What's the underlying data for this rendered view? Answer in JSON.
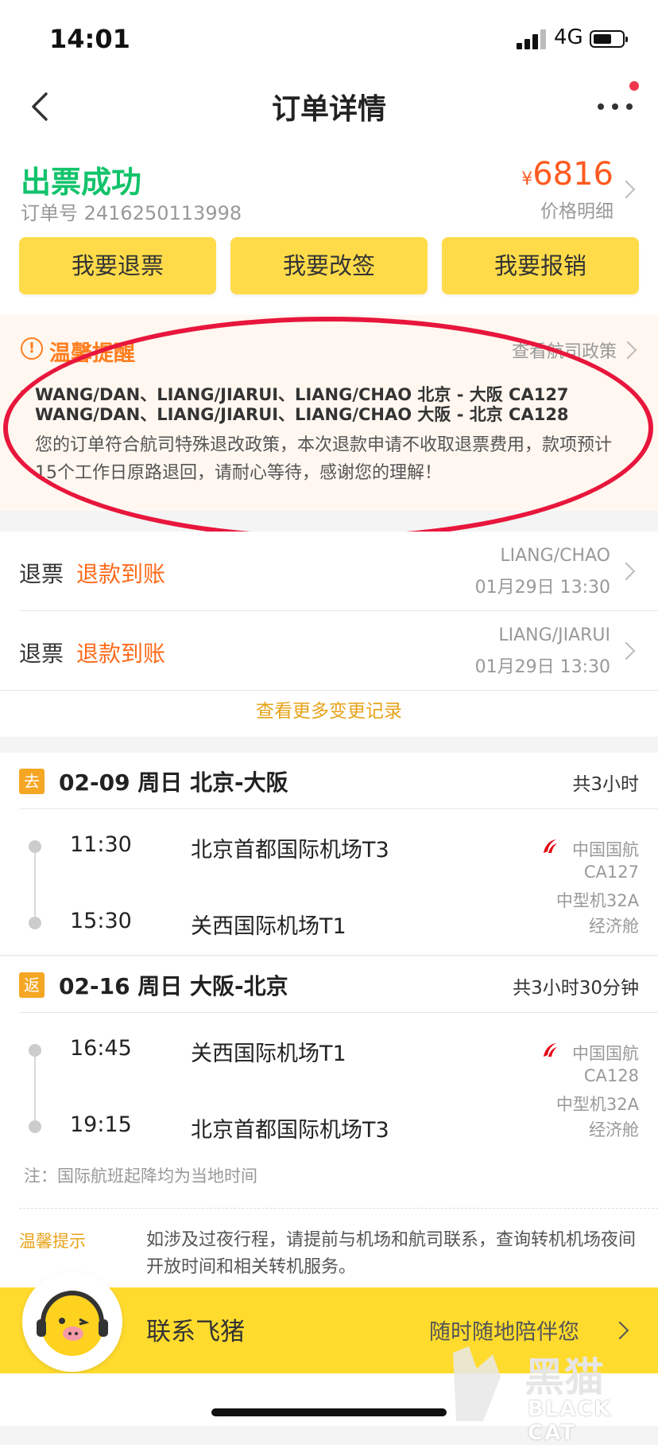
{
  "status_bar": {
    "time": "14:01",
    "network": "4G"
  },
  "nav": {
    "title": "订单详情"
  },
  "order": {
    "status": "出票成功",
    "order_no": "订单号 2416250113998",
    "currency": "¥",
    "price": "6816",
    "price_detail": "价格明细"
  },
  "actions": {
    "refund": "我要退票",
    "change": "我要改签",
    "reimburse": "我要报销"
  },
  "notice": {
    "title": "温馨提醒",
    "link": "查看航司政策",
    "pax_line_1": "WANG/DAN、LIANG/JIARUI、LIANG/CHAO 北京 - 大阪 CA127",
    "pax_line_2": "WANG/DAN、LIANG/JIARUI、LIANG/CHAO 大阪 - 北京 CA128",
    "message": "您的订单符合航司特殊退改政策，本次退款申请不收取退票费用，款项预计15个工作日原路退回，请耐心等待，感谢您的理解！"
  },
  "refunds": [
    {
      "label": "退票",
      "status": "退款到账",
      "name": "LIANG/CHAO",
      "time": "01月29日 13:30"
    },
    {
      "label": "退票",
      "status": "退款到账",
      "name": "LIANG/JIARUI",
      "time": "01月29日 13:30"
    }
  ],
  "more_records": "查看更多变更记录",
  "segments": [
    {
      "badge": "去",
      "header": "02-09 周日 北京-大阪",
      "duration": "共3小时",
      "dep_time": "11:30",
      "dep_airport": "北京首都国际机场T3",
      "arr_time": "15:30",
      "arr_airport": "关西国际机场T1",
      "airline": "中国国航",
      "flight": "CA127",
      "aircraft": "中型机32A",
      "cabin": "经济舱"
    },
    {
      "badge": "返",
      "header": "02-16 周日 大阪-北京",
      "duration": "共3小时30分钟",
      "dep_time": "16:45",
      "dep_airport": "关西国际机场T1",
      "arr_time": "19:15",
      "arr_airport": "北京首都国际机场T3",
      "airline": "中国国航",
      "flight": "CA128",
      "aircraft": "中型机32A",
      "cabin": "经济舱"
    }
  ],
  "note": "注：国际航班起降均为当地时间",
  "tip": {
    "label": "温馨提示",
    "text": "如涉及过夜行程，请提前与机场和航司联系，查询转机机场夜间开放时间和相关转机服务。"
  },
  "contact": {
    "label": "联系飞猪",
    "sub": "随时随地陪伴您"
  },
  "watermark": {
    "text": "BLACK CAT",
    "logo_text": "黑猫"
  },
  "colors": {
    "success": "#12c36b",
    "accent": "#ff6a1a",
    "button": "#ffdb4a",
    "badge": "#f5a623",
    "annotation": "#e8163c"
  }
}
